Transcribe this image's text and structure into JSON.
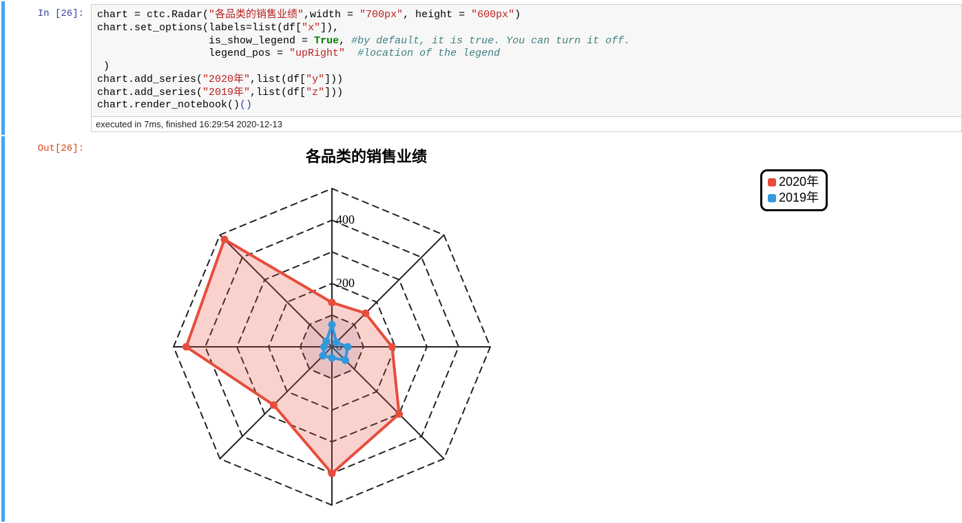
{
  "in_prompt": "In [26]:",
  "out_prompt": "Out[26]:",
  "code": {
    "l1_a": "chart = ctc.Radar(",
    "l1_str": "\"各品类的销售业绩\"",
    "l1_b": ",width = ",
    "l1_str2": "\"700px\"",
    "l1_c": ", height = ",
    "l1_str3": "\"600px\"",
    "l1_d": ")",
    "l2_a": "chart.set_options(labels=list(df[",
    "l2_str": "\"x\"",
    "l2_b": "]),",
    "l3_a": "                  is_show_legend = ",
    "l3_kw": "True",
    "l3_b": ", ",
    "l3_cmt": "#by default, it is true. You can turn it off.",
    "l4_a": "                  legend_pos = ",
    "l4_str": "\"upRight\"",
    "l4_b": "  ",
    "l4_cmt": "#location of the legend",
    "l5": " )",
    "l6_a": "chart.add_series(",
    "l6_str": "\"2020年\"",
    "l6_b": ",list(df[",
    "l6_str2": "\"y\"",
    "l6_c": "]))",
    "l7_a": "chart.add_series(",
    "l7_str": "\"2019年\"",
    "l7_b": ",list(df[",
    "l7_str2": "\"z\"",
    "l7_c": "]))",
    "l8": "chart.render_notebook()"
  },
  "exec_status": "executed in 7ms, finished 16:29:54 2020-12-13",
  "chart_data": {
    "type": "radar",
    "title": "各品类的销售业绩",
    "axis_max": 500,
    "ticks": [
      0,
      200,
      400
    ],
    "n_axes": 8,
    "series": [
      {
        "name": "2020年",
        "color": "#E74C3C",
        "fill": "rgba(231,76,60,0.25)",
        "values": [
          140,
          150,
          190,
          300,
          400,
          260,
          460,
          480
        ]
      },
      {
        "name": "2019年",
        "color": "#3498DB",
        "fill": "rgba(52,152,219,0.25)",
        "values": [
          70,
          20,
          50,
          60,
          35,
          40,
          25,
          25
        ]
      }
    ],
    "legend_pos": "upRight"
  }
}
